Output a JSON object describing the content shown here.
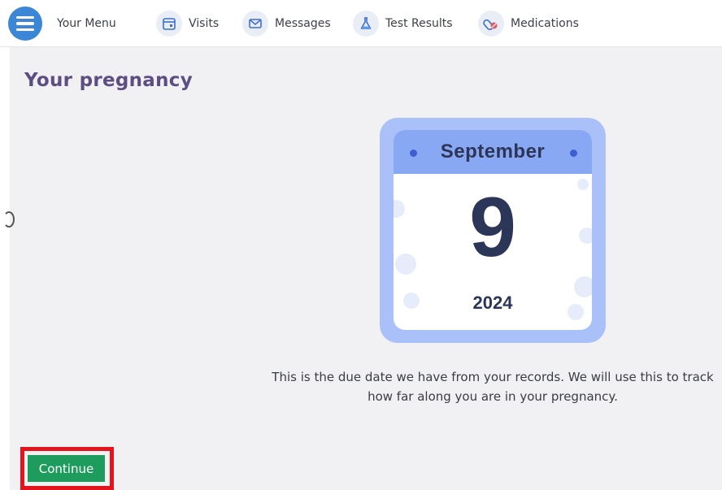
{
  "nav": {
    "menu_label": "Your Menu",
    "items": [
      {
        "label": "Visits",
        "icon": "calendar-icon"
      },
      {
        "label": "Messages",
        "icon": "envelope-icon"
      },
      {
        "label": "Test Results",
        "icon": "flask-icon"
      },
      {
        "label": "Medications",
        "icon": "pills-icon"
      }
    ]
  },
  "page": {
    "title": "Your pregnancy"
  },
  "due_date": {
    "month": "September",
    "day": "9",
    "year": "2024"
  },
  "description": "This is the due date we have from your records. We will use this to track how far along you are in your pregnancy.",
  "actions": {
    "continue_label": "Continue"
  },
  "colors": {
    "brand_blue": "#3b86d6",
    "calendar_frame": "#a9c0f8",
    "calendar_header": "#89a8f4",
    "title_purple": "#5c4e82",
    "continue_green": "#1d9c5d",
    "highlight_red": "#e3141b"
  }
}
